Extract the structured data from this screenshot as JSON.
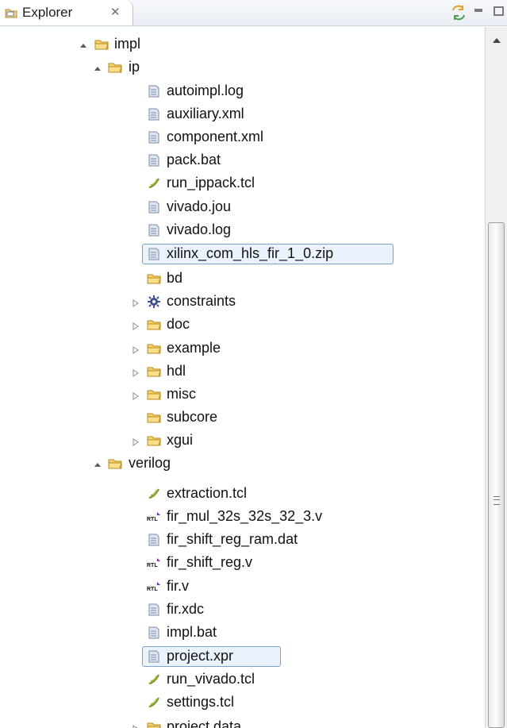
{
  "explorer": {
    "title": "Explorer",
    "close_glyph": "✕",
    "tab_icon": "package-explorer-icon",
    "toolbar_icons": [
      "link-with-editor-icon",
      "minimize-icon",
      "maximize-icon"
    ]
  },
  "tree": {
    "items": [
      {
        "label": "impl",
        "icon": "folder-open-icon",
        "expanded": true
      },
      {
        "label": "ip",
        "icon": "folder-open-icon",
        "expanded": true
      },
      {
        "label": "autoimpl.log",
        "icon": "text-file-icon"
      },
      {
        "label": "auxiliary.xml",
        "icon": "text-file-icon"
      },
      {
        "label": "component.xml",
        "icon": "text-file-icon"
      },
      {
        "label": "pack.bat",
        "icon": "text-file-icon"
      },
      {
        "label": "run_ippack.tcl",
        "icon": "tcl-script-icon"
      },
      {
        "label": "vivado.jou",
        "icon": "text-file-icon"
      },
      {
        "label": "vivado.log",
        "icon": "text-file-icon"
      },
      {
        "label": "xilinx_com_hls_fir_1_0.zip",
        "icon": "text-file-icon",
        "selected": true
      },
      {
        "label": "bd",
        "icon": "folder-open-icon"
      },
      {
        "label": "constraints",
        "icon": "constraints-folder-icon",
        "expandable": true
      },
      {
        "label": "doc",
        "icon": "folder-open-icon",
        "expandable": true
      },
      {
        "label": "example",
        "icon": "folder-open-icon",
        "expandable": true
      },
      {
        "label": "hdl",
        "icon": "folder-open-icon",
        "expandable": true
      },
      {
        "label": "misc",
        "icon": "folder-open-icon",
        "expandable": true
      },
      {
        "label": "subcore",
        "icon": "folder-open-icon"
      },
      {
        "label": "xgui",
        "icon": "folder-open-icon",
        "expandable": true
      },
      {
        "label": "verilog",
        "icon": "folder-open-icon",
        "expanded": true
      },
      {
        "label": "extraction.tcl",
        "icon": "tcl-script-icon"
      },
      {
        "label": "fir_mul_32s_32s_32_3.v",
        "icon": "rtl-file-icon"
      },
      {
        "label": "fir_shift_reg_ram.dat",
        "icon": "text-file-icon"
      },
      {
        "label": "fir_shift_reg.v",
        "icon": "rtl-file-icon"
      },
      {
        "label": "fir.v",
        "icon": "rtl-file-icon"
      },
      {
        "label": "fir.xdc",
        "icon": "text-file-icon"
      },
      {
        "label": "impl.bat",
        "icon": "text-file-icon"
      },
      {
        "label": "project.xpr",
        "icon": "text-file-icon",
        "selected": true
      },
      {
        "label": "run_vivado.tcl",
        "icon": "tcl-script-icon"
      },
      {
        "label": "settings.tcl",
        "icon": "tcl-script-icon"
      },
      {
        "label": "project.data",
        "icon": "folder-open-icon",
        "expandable": true
      }
    ]
  },
  "colors": {
    "selection_fill": "#eaf3fc",
    "selection_border": "#7da2ce",
    "folder": "#f2c86d",
    "file": "#c8d2e0"
  }
}
